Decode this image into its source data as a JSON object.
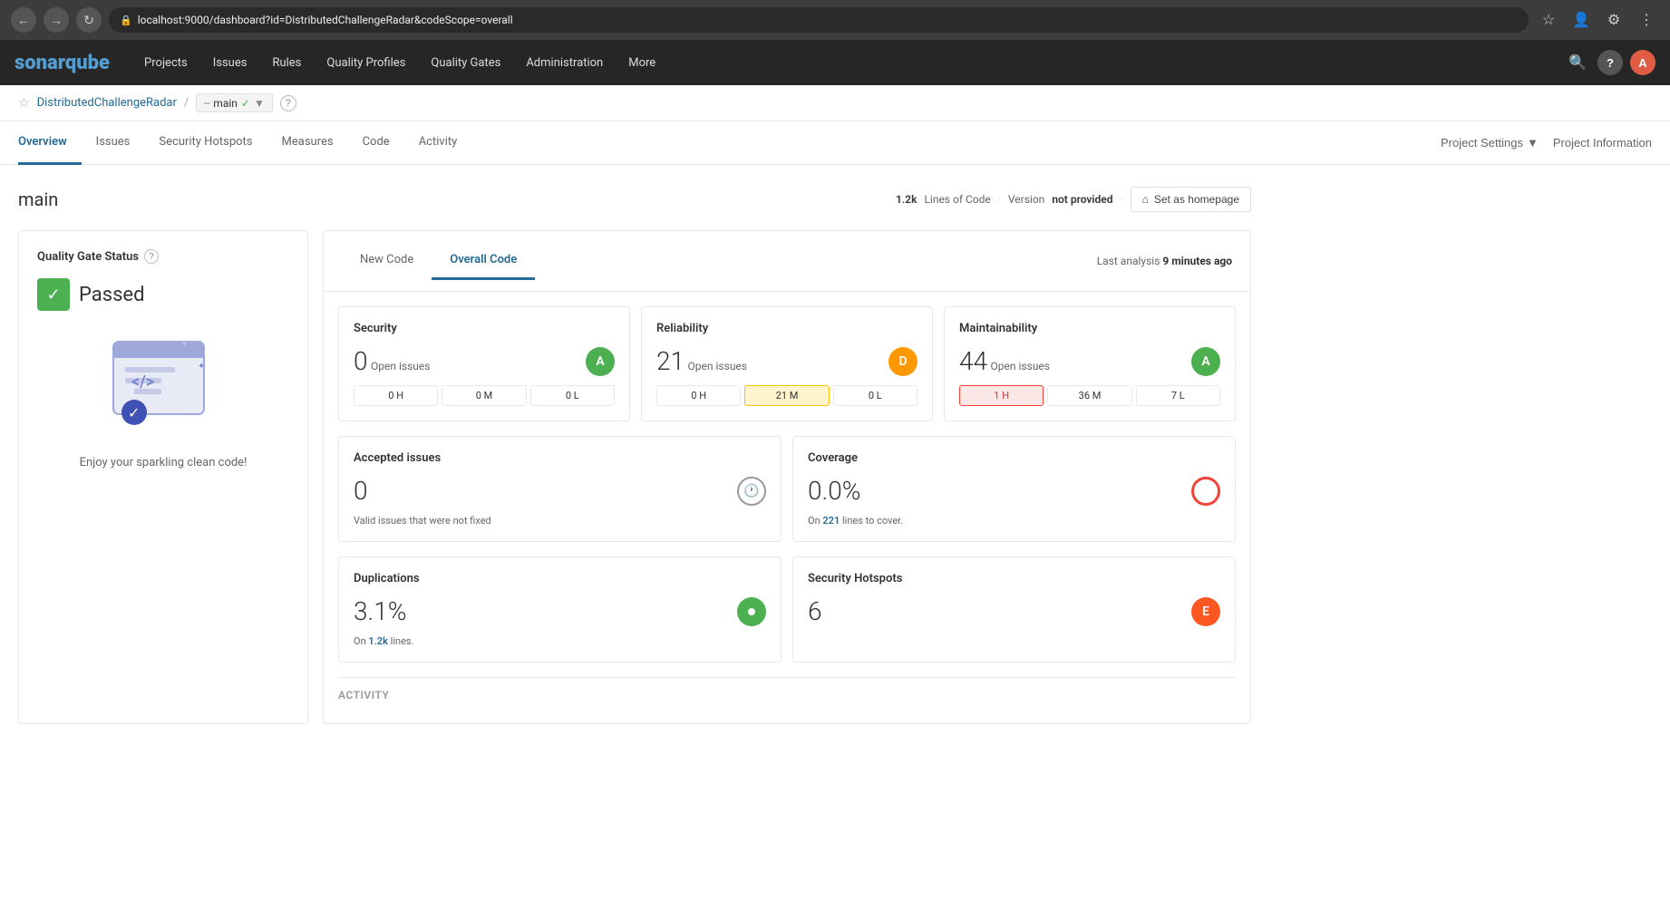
{
  "browser": {
    "url": "localhost:9000/dashboard?id=DistributedChallengeRadar&codeScope=overall",
    "back_title": "Back",
    "forward_title": "Forward",
    "refresh_title": "Refresh"
  },
  "topnav": {
    "logo": "SonarQube",
    "items": [
      "Projects",
      "Issues",
      "Rules",
      "Quality Profiles",
      "Quality Gates",
      "Administration",
      "More"
    ],
    "help_label": "?",
    "avatar_label": "A"
  },
  "breadcrumb": {
    "project_name": "DistributedChallengeRadar",
    "branch_name": "main",
    "help_label": "?"
  },
  "subnav": {
    "items": [
      "Overview",
      "Issues",
      "Security Hotspots",
      "Measures",
      "Code",
      "Activity"
    ],
    "active": "Overview",
    "project_settings_label": "Project Settings",
    "project_info_label": "Project Information"
  },
  "project": {
    "name": "main",
    "loc_count": "1.2k",
    "loc_label": "Lines of Code",
    "version_label": "Version",
    "version_value": "not provided",
    "homepage_label": "Set as homepage"
  },
  "quality_gate": {
    "title": "Quality Gate Status",
    "help_label": "?",
    "status": "Passed",
    "message": "Enjoy your sparkling clean code!"
  },
  "metrics": {
    "last_analysis_prefix": "Last analysis",
    "last_analysis_time": "9 minutes ago",
    "tabs": [
      "New Code",
      "Overall Code"
    ],
    "active_tab": "Overall Code",
    "cards": [
      {
        "title": "Security",
        "value": "0",
        "label": "Open issues",
        "grade": "A",
        "grade_class": "grade-a",
        "breakdown": [
          "0 H",
          "0 M",
          "0 L"
        ],
        "breakdown_highlights": [
          "",
          "",
          ""
        ]
      },
      {
        "title": "Reliability",
        "value": "21",
        "label": "Open issues",
        "grade": "D",
        "grade_class": "grade-d",
        "breakdown": [
          "0 H",
          "21 M",
          "0 L"
        ],
        "breakdown_highlights": [
          "",
          "highlight-yellow",
          ""
        ]
      },
      {
        "title": "Maintainability",
        "value": "44",
        "label": "Open issues",
        "grade": "A",
        "grade_class": "grade-a",
        "breakdown": [
          "1 H",
          "36 M",
          "7 L"
        ],
        "breakdown_highlights": [
          "highlight-red",
          "",
          ""
        ]
      }
    ],
    "accepted_issues": {
      "title": "Accepted issues",
      "value": "0",
      "sublabel": "Valid issues that were not fixed"
    },
    "coverage": {
      "title": "Coverage",
      "value": "0.0%",
      "sublabel_prefix": "On",
      "sublabel_count": "221",
      "sublabel_suffix": "lines to cover."
    },
    "duplications": {
      "title": "Duplications",
      "value": "3.1%",
      "sublabel_prefix": "On",
      "sublabel_count": "1.2k",
      "sublabel_suffix": "lines."
    },
    "security_hotspots": {
      "title": "Security Hotspots",
      "value": "6",
      "grade": "E",
      "grade_class": "grade-e"
    },
    "activity_title": "ACTIVITY"
  }
}
